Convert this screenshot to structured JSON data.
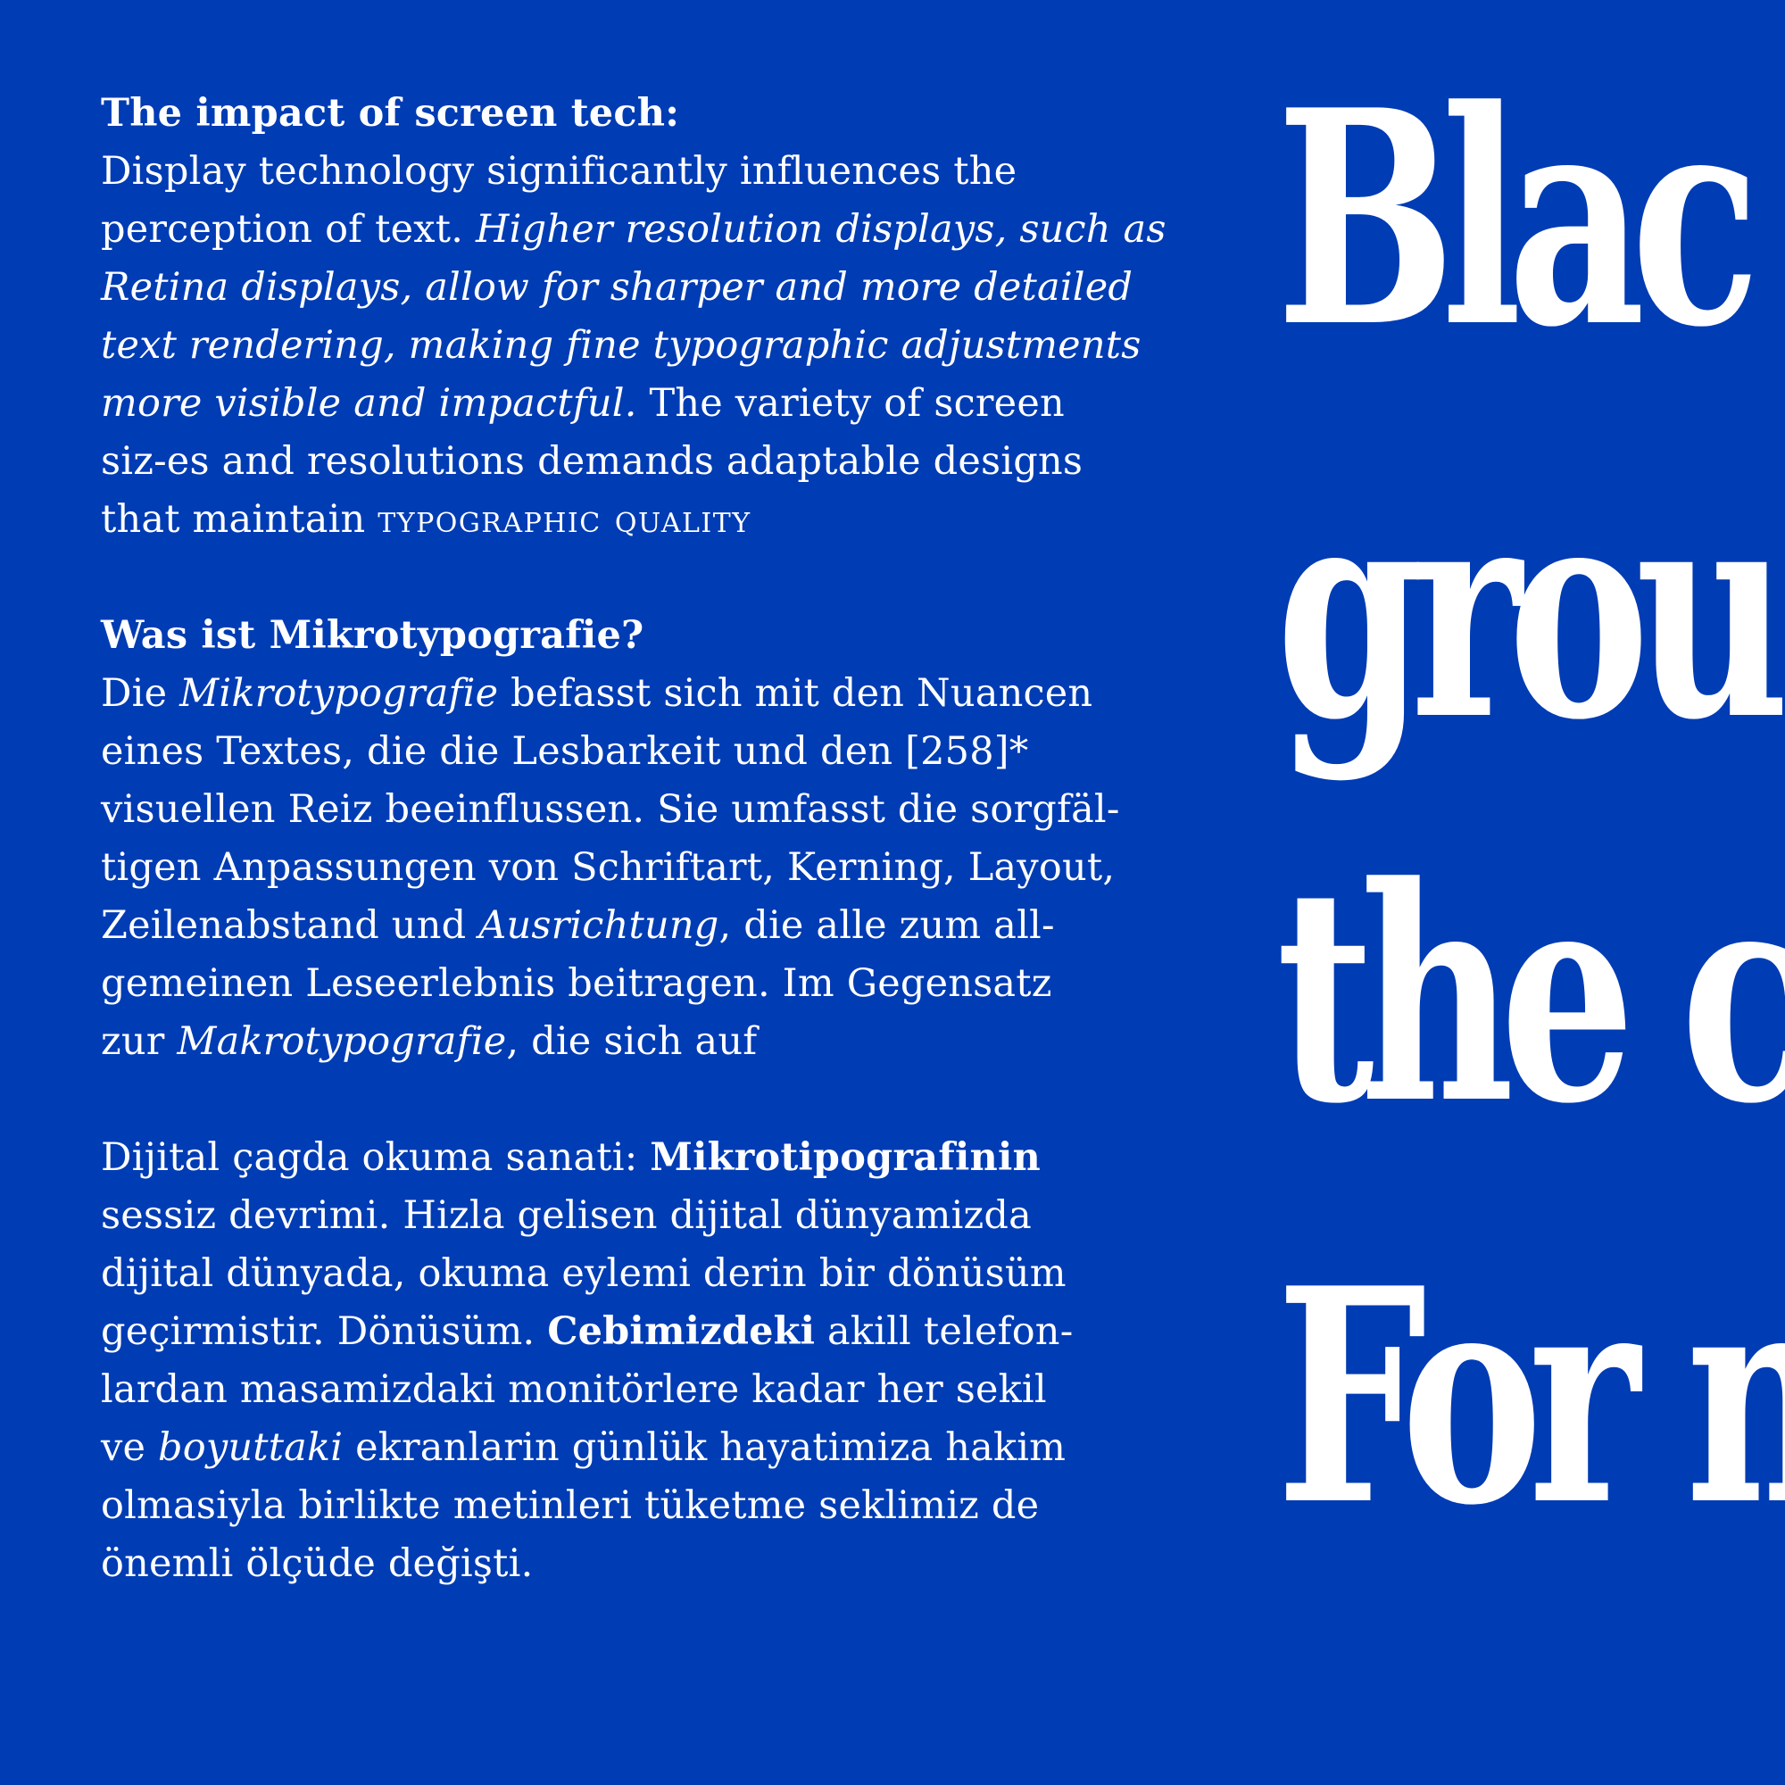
{
  "background_color": "#003cb4",
  "text_color": "#ffffff",
  "sections": [
    {
      "heading": "The impact of screen tech:",
      "lines": [
        [
          {
            "t": "Display technology significantly influences the"
          }
        ],
        [
          {
            "t": "perception of text. "
          },
          {
            "t": "Higher resolution displays, such as",
            "s": "i"
          }
        ],
        [
          {
            "t": "Retina displays, allow for sharper and more detailed",
            "s": "i"
          }
        ],
        [
          {
            "t": "text rendering, making fine typographic adjustments",
            "s": "i"
          }
        ],
        [
          {
            "t": "more visible and impactful.",
            "s": "i"
          },
          {
            "t": " The variety of screen"
          }
        ],
        [
          {
            "t": "siz-es and resolutions demands adaptable designs"
          }
        ],
        [
          {
            "t": "that maintain "
          },
          {
            "t": "TYPOGRAPHIC QUALITY",
            "s": "sc"
          }
        ]
      ]
    },
    {
      "heading": "Was ist Mikrotypografie?",
      "lines": [
        [
          {
            "t": "Die "
          },
          {
            "t": "Mikrotypografie",
            "s": "i"
          },
          {
            "t": " befasst sich mit den Nuancen"
          }
        ],
        [
          {
            "t": "eines Textes, die die Lesbarkeit und den [258]*"
          }
        ],
        [
          {
            "t": "visuellen Reiz beeinflussen. Sie umfasst die sorgfäl-"
          }
        ],
        [
          {
            "t": "tigen Anpassungen von Schriftart, Kerning, Layout,"
          }
        ],
        [
          {
            "t": "Zeilenabstand und "
          },
          {
            "t": "Ausrichtung",
            "s": "i"
          },
          {
            "t": ", die alle zum all-"
          }
        ],
        [
          {
            "t": "gemeinen Leseerlebnis beitragen. Im Gegensatz"
          }
        ],
        [
          {
            "t": "zur "
          },
          {
            "t": "Makrotypografie",
            "s": "i"
          },
          {
            "t": ", die sich auf"
          }
        ]
      ]
    },
    {
      "heading": "",
      "lines": [
        [
          {
            "t": "Dijital çagda okuma sanati: "
          },
          {
            "t": "Mikrotipografinin",
            "s": "b"
          }
        ],
        [
          {
            "t": "sessiz devrimi. Hizla gelisen dijital dünyamizda"
          }
        ],
        [
          {
            "t": "dijital dünyada, okuma eylemi derin bir dönüsüm"
          }
        ],
        [
          {
            "t": "geçirmistir. Dönüsüm. "
          },
          {
            "t": "Cebimizdeki",
            "s": "b"
          },
          {
            "t": " akill telefon-"
          }
        ],
        [
          {
            "t": "lardan masamizdaki monitörlere kadar her sekil"
          }
        ],
        [
          {
            "t": "ve "
          },
          {
            "t": "boyuttaki",
            "s": "i"
          },
          {
            "t": " ekranlarin günlük hayatimiza hakim"
          }
        ],
        [
          {
            "t": "olmasiyla birlikte metinleri tüketme seklimiz de"
          }
        ],
        [
          {
            "t": "önemli ölçüde değişti."
          }
        ]
      ]
    }
  ],
  "display_words": [
    "Blac",
    "grou",
    "the c",
    "For n"
  ]
}
